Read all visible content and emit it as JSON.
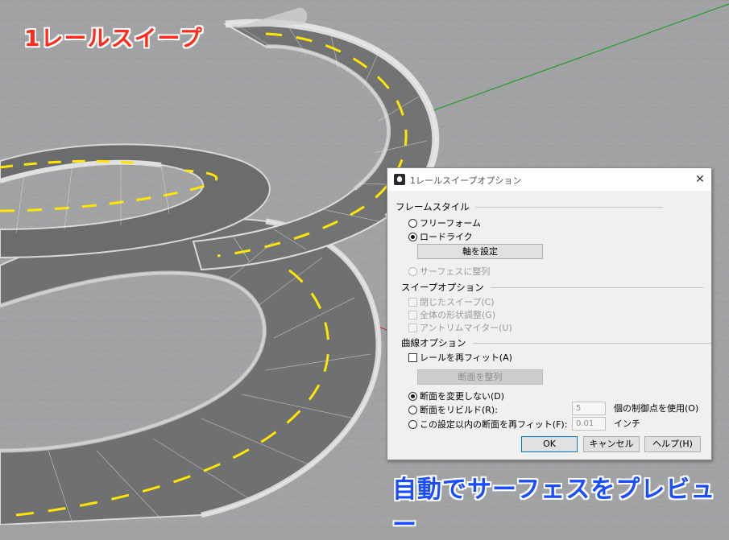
{
  "captions": {
    "top": "1レールスイープ",
    "bottom": "自動でサーフェスをプレビュー"
  },
  "colors": {
    "caption_top": "#ff2a1a",
    "caption_bottom": "#1a4dff",
    "rail_dash": "#ffe600",
    "grid_background": "#9fa1a3",
    "axis_x": "#b03030",
    "axis_y": "#2a9a2a"
  },
  "dialog": {
    "title": "1レールスイープオプション",
    "close_icon": "close-icon",
    "frame_style": {
      "header": "フレームスタイル",
      "freeform": "フリーフォーム",
      "roadlike": "ロードライク",
      "set_axis": "軸を設定",
      "align_to_surface": "サーフェスに整列"
    },
    "sweep_options": {
      "header": "スイープオプション",
      "closed_sweep": "閉じたスイープ(C)",
      "global_shape_blending": "全体の形状調整(G)",
      "untrimmed_miters": "アントリムマイター(U)"
    },
    "curve_options": {
      "header": "曲線オプション",
      "refit_rail": "レールを再フィット(A)",
      "align_cross_sections": "断面を整列",
      "do_not_change": "断面を変更しない(D)",
      "rebuild": "断面をリビルド(R):",
      "rebuild_value": "5",
      "rebuild_unit": "個の制御点を使用(O)",
      "refit_within": "この設定以内の断面を再フィット(F):",
      "refit_value": "0.01",
      "refit_unit": "インチ"
    },
    "buttons": {
      "ok": "OK",
      "cancel": "キャンセル",
      "help": "ヘルプ(H)"
    }
  }
}
